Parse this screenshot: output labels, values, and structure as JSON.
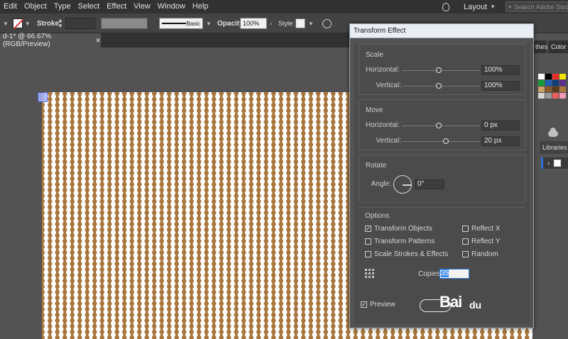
{
  "menu": [
    "Edit",
    "Object",
    "Type",
    "Select",
    "Effect",
    "View",
    "Window",
    "Help"
  ],
  "menu_right": {
    "layout_label": "Layout",
    "search_placeholder": "Search Adobe Stock"
  },
  "control_bar": {
    "stroke_label": "Stroke:",
    "stroke_style_label": "Basic",
    "opacity_label": "Opacity:",
    "opacity_value": "100%",
    "style_label": "Style:"
  },
  "doc_tab": {
    "title": "d-1* @ 66.67% (RGB/Preview)",
    "close": "✕"
  },
  "right_panel": {
    "tab_swatches": "thes",
    "tab_color": "Color",
    "tab_libraries": "Libraries"
  },
  "dialog": {
    "title": "Transform Effect",
    "scale": {
      "title": "Scale",
      "horizontal_label": "Horizontal:",
      "horizontal_value": "100%",
      "vertical_label": "Vertical:",
      "vertical_value": "100%"
    },
    "move": {
      "title": "Move",
      "horizontal_label": "Horizontal:",
      "horizontal_value": "0 px",
      "vertical_label": "Vertical:",
      "vertical_value": "20 px"
    },
    "rotate": {
      "title": "Rotate",
      "angle_label": "Angle:",
      "angle_value": "0°"
    },
    "options": {
      "title": "Options",
      "transform_objects": "Transform Objects",
      "transform_patterns": "Transform Patterns",
      "scale_strokes": "Scale Strokes & Effects",
      "reflect_x": "Reflect X",
      "reflect_y": "Reflect Y",
      "random": "Random",
      "copies_label": "Copies",
      "copies_value": "35",
      "preview_label": "Preview",
      "checked_transform_objects": true,
      "checked_preview": true
    },
    "watermark": {
      "brand": "Bai",
      "suffix": "du"
    }
  },
  "colors": {
    "artwork_fill": "#a9763d",
    "dot_color": "#ffffff",
    "dialog_title_bg": "#e9eef4",
    "accent": "#2d7be5"
  },
  "swatches": [
    "#ffffff",
    "#000000",
    "#e8312a",
    "#f5e400",
    "#1a9c3c",
    "#1f5fb5",
    "#0d3f7a",
    "#5b2d8c",
    "#c9a36b",
    "#8a5a2b",
    "#5c3a1a",
    "#a9763d",
    "#d8d8d8",
    "#9a9a9a",
    "#e95e5e",
    "#f29ab5"
  ]
}
